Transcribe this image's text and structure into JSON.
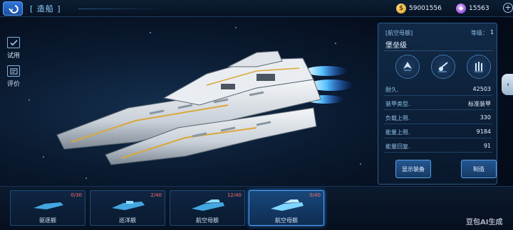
{
  "header": {
    "page_title": "[ 造船 ]",
    "gold_amount": "59001556",
    "gem_amount": "15563",
    "plus_symbol": "+"
  },
  "side_menu": {
    "trial_label": "试用",
    "review_label": "评价"
  },
  "ship_panel": {
    "ship_class": "[航空母舰]",
    "level_label": "等级：",
    "level_value": "1",
    "ship_name": "堡垒级",
    "stats": [
      {
        "key": "耐久.",
        "value": "42503"
      },
      {
        "key": "装甲类型.",
        "value": "标准装甲"
      },
      {
        "key": "负载上限.",
        "value": "330"
      },
      {
        "key": "能量上限.",
        "value": "9184"
      },
      {
        "key": "能量回复.",
        "value": "91"
      }
    ],
    "show_equipment_label": "显示装备",
    "build_label": "制造"
  },
  "ship_tabs": [
    {
      "name": "驱逐舰",
      "count": "0/30"
    },
    {
      "name": "巡洋舰",
      "count": "2/40"
    },
    {
      "name": "航空母舰",
      "count": "12/40"
    },
    {
      "name": "航空母舰",
      "count": "0/40"
    }
  ],
  "active_tab_index": 3,
  "watermark": "豆包AI生成",
  "colors": {
    "accent": "#4fa3ff",
    "panel_border": "#2b5c8c",
    "count_red": "#ff6b6b"
  }
}
